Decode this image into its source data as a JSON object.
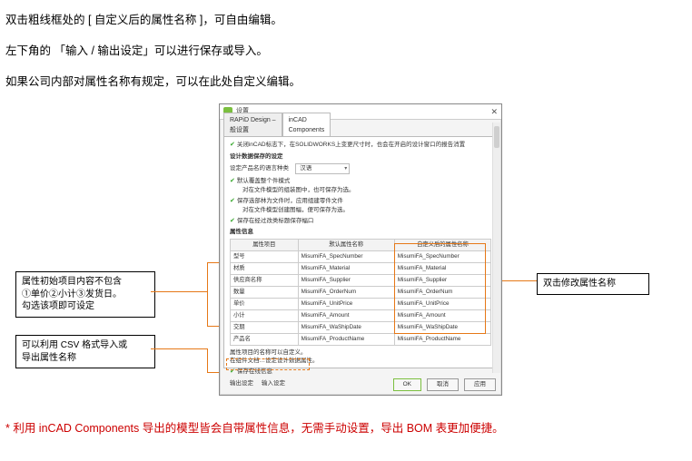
{
  "paragraphs": {
    "p1": "双击粗线框处的 [ 自定义后的属性名称 ]，可自由编辑。",
    "p2": "左下角的 「输入 / 输出设定」可以进行保存或导入。",
    "p3": "如果公司内部对属性名称有规定，可以在此处自定义编辑。"
  },
  "callouts": {
    "left1_l1": "属性初始项目内容不包含",
    "left1_l2": "①单价②小计③发货日。",
    "left1_l3": "勾选该项即可设定",
    "left2_l1": "可以利用 CSV 格式导入或",
    "left2_l2": "导出属性名称",
    "right_l1": "双击修改属性名称"
  },
  "dialog": {
    "title": "设置",
    "tab1_l1": "RAPiD Design –",
    "tab1_l2": "般设置",
    "tab2_l1": "inCAD",
    "tab2_l2": "Components",
    "banner": "关闭inCAD标志下，在SOLIDWORKS上变更尺寸时，也会在开启的设计窗口的报告消置",
    "sec1": "设计数据保存的设定",
    "lang_label": "设定产品名的语言种类",
    "lang_value": "汉语",
    "opt1a": "默认覆盖整个件模式",
    "opt1b": "对在文件模型的组装图中，也可保存为选。",
    "opt2a": "保存选部林为文件时，应用组建零件文件",
    "opt2b": "对在文件模型创建图幅，便可保存为选。",
    "opt3": "保存在经过改类标题保存幅口",
    "sec2": "属性信息",
    "th1": "属性项目",
    "th2": "默认属性名称",
    "th3": "自定义后的属性名称",
    "rows": [
      {
        "a": "型号",
        "b": "MisumiFA_SpecNumber",
        "c": "MisumiFA_SpecNumber"
      },
      {
        "a": "材质",
        "b": "MisumiFA_Material",
        "c": "MisumiFA_Material"
      },
      {
        "a": "供应商名称",
        "b": "MisumiFA_Supplier",
        "c": "MisumiFA_Supplier"
      },
      {
        "a": "数量",
        "b": "MisumiFA_OrderNum",
        "c": "MisumiFA_OrderNum"
      },
      {
        "a": "单价",
        "b": "MisumiFA_UnitPrice",
        "c": "MisumiFA_UnitPrice"
      },
      {
        "a": "小计",
        "b": "MisumiFA_Amount",
        "c": "MisumiFA_Amount"
      },
      {
        "a": "交期",
        "b": "MisumiFA_WaShipDate",
        "c": "MisumiFA_WaShipDate"
      },
      {
        "a": "产品名",
        "b": "MisumiFA_ProductName",
        "c": "MisumiFA_ProductName"
      }
    ],
    "rows_hint": "属性项目的名称可以自定义。",
    "rows_hint2": "在组件文档…设定设计数据属性。",
    "save_cb": "保存在线信息",
    "io_out": "输出设定",
    "io_in": "输入设定",
    "btn_ok": "OK",
    "btn_cancel": "取消",
    "btn_apply": "应用"
  },
  "footnote": "* 利用 inCAD Components 导出的模型皆会自带属性信息，无需手动设置，导出 BOM 表更加便捷。"
}
